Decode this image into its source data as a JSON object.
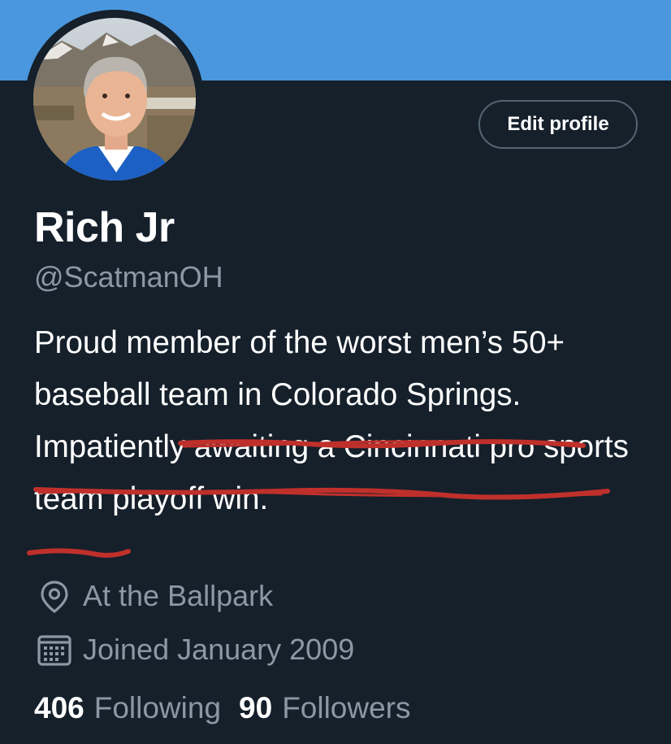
{
  "profile": {
    "display_name": "Rich Jr",
    "handle": "@ScatmanOH",
    "edit_button_label": "Edit profile",
    "bio_plain_1": "Proud member of the worst men’s 50+ baseball team in Colorado Springs.",
    "bio_struck": "Impatiently awaiting a Cincinnati pro sports team playoff win.",
    "location": "At the Ballpark",
    "joined": "Joined January 2009",
    "following_count": "406",
    "following_label": "Following",
    "followers_count": "90",
    "followers_label": "Followers"
  },
  "icons": {
    "location": "map-pin-icon",
    "joined": "calendar-icon"
  },
  "colors": {
    "background": "#15202b",
    "banner": "#4a97de",
    "secondary_text": "#8b98a5",
    "scribble": "#c0302b"
  }
}
